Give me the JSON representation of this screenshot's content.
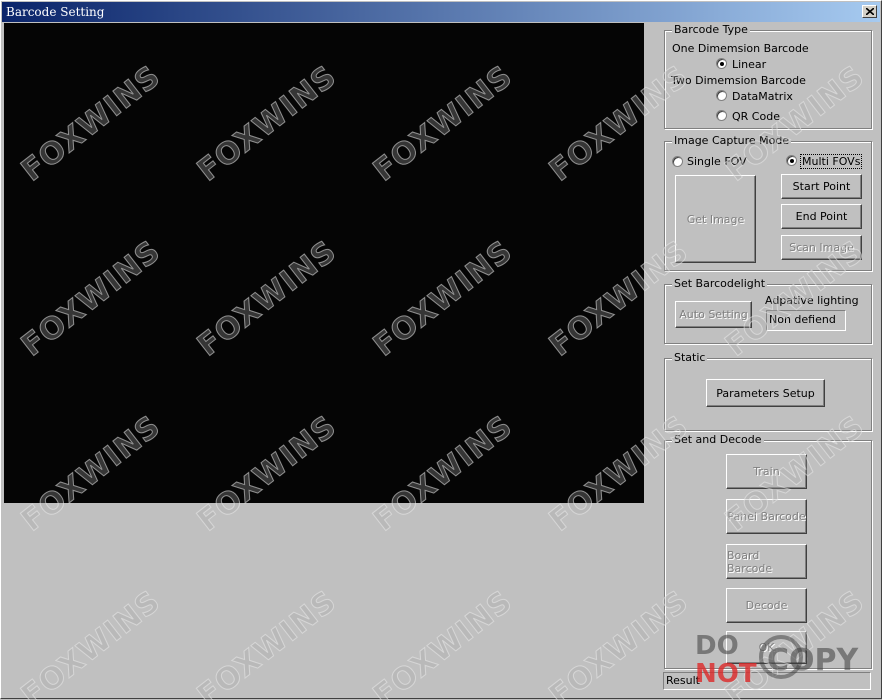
{
  "window": {
    "title": "Barcode Setting"
  },
  "barcode_type": {
    "title": "Barcode Type",
    "one_dim_label": "One Dimemsion Barcode",
    "linear_label": "Linear",
    "two_dim_label": "Two Dimemsion Barcode",
    "datamatrix_label": "DataMatrix",
    "qr_label": "QR Code",
    "selected": "Linear"
  },
  "capture_mode": {
    "title": "Image Capture Mode",
    "single_label": "Single FOV",
    "multi_label": "Multi FOVs",
    "selected": "Multi FOVs",
    "get_image": "Get Image",
    "start_point": "Start Point",
    "end_point": "End Point",
    "scan_image": "Scan Image"
  },
  "barcodelight": {
    "title": "Set Barcodelight",
    "auto_setting": "Auto Setting",
    "adaptive_label": "Adpative lighting",
    "adaptive_value": "Non defiend"
  },
  "static": {
    "title": "Static",
    "parameters_setup": "Parameters Setup"
  },
  "decode": {
    "title": "Set and Decode",
    "train": "Train",
    "panel_barcode": "Panel Barcode",
    "board_barcode": "Board Barcode",
    "decode": "Decode",
    "ok": "OK"
  },
  "status": {
    "result": "Result"
  },
  "watermark": {
    "text": "FOXWINS",
    "stamp_do": "DO",
    "stamp_not": "NOT",
    "stamp_copy": "COPY"
  }
}
